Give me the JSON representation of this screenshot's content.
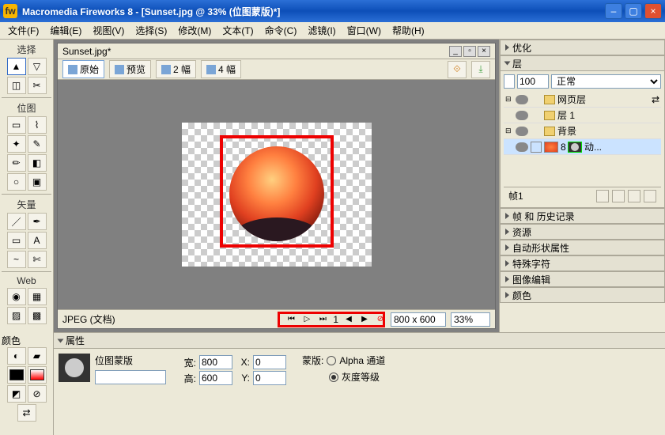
{
  "window": {
    "title": "Macromedia Fireworks 8 - [Sunset.jpg @ 33% (位图蒙版)*]"
  },
  "menu": {
    "file": "文件(F)",
    "edit": "编辑(E)",
    "view": "视图(V)",
    "select": "选择(S)",
    "modify": "修改(M)",
    "text": "文本(T)",
    "command": "命令(C)",
    "filter": "滤镜(I)",
    "window": "窗口(W)",
    "help": "帮助(H)"
  },
  "tool_sections": {
    "select": "选择",
    "bitmap": "位图",
    "vector": "矢量",
    "web": "Web",
    "color": "颜色"
  },
  "document": {
    "tab": "Sunset.jpg*",
    "views": {
      "original": "原始",
      "preview": "预览",
      "twoup": "2 幅",
      "fourup": "4 幅"
    },
    "format": "JPEG (文档)",
    "frame_no": "1",
    "dims": "800 x 600",
    "zoom": "33%"
  },
  "panels": {
    "optimize": "优化",
    "layers": "层",
    "opacity": "100",
    "blend": "正常",
    "layer_web": "网页层",
    "layer1": "层 1",
    "layer_bg": "背景",
    "sublayer": "动...",
    "frame_label": "帧1",
    "frames_history": "帧 和 历史记录",
    "assets": "资源",
    "autoshape": "自动形状属性",
    "specialchars": "特殊字符",
    "imageedit": "图像编辑",
    "colors": "颜色"
  },
  "properties": {
    "title": "属性",
    "type": "位图蒙版",
    "mask_label": "蒙版:",
    "alpha": "Alpha 通道",
    "gray": "灰度等级",
    "w_label": "宽:",
    "w": "800",
    "h_label": "高:",
    "h": "600",
    "x_label": "X:",
    "x": "0",
    "y_label": "Y:",
    "y": "0"
  }
}
